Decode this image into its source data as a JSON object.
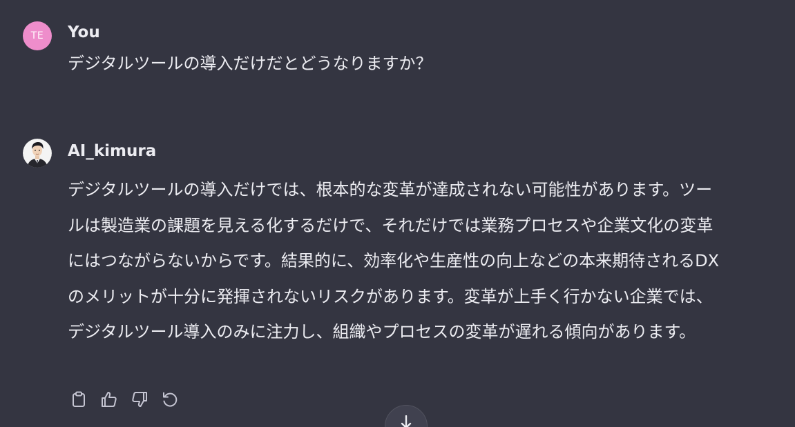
{
  "user_message": {
    "avatar_initials": "TE",
    "avatar_color": "#ee8dcb",
    "author": "You",
    "text": "デジタルツールの導入だけだとどうなりますか？"
  },
  "ai_message": {
    "author": "AI_kimura",
    "text": "デジタルツールの導入だけでは、根本的な変革が達成されない可能性があります。ツールは製造業の課題を見える化するだけで、それだけでは業務プロセスや企業文化の変革にはつながらないからです。結果的に、効率化や生産性の向上などの本来期待されるDXのメリットが十分に発揮されないリスクがあります。変革が上手く行かない企業では、デジタルツール導入のみに注力し、組織やプロセスの変革が遅れる傾向があります。"
  },
  "actions": [
    {
      "icon": "clipboard-icon",
      "name": "copy-button"
    },
    {
      "icon": "thumbs-up-icon",
      "name": "thumbs-up-button"
    },
    {
      "icon": "thumbs-down-icon",
      "name": "thumbs-down-button"
    },
    {
      "icon": "regenerate-icon",
      "name": "regenerate-button"
    }
  ],
  "theme": {
    "background": "#343541",
    "text": "#ececf1",
    "icon": "#c5c5d2"
  }
}
